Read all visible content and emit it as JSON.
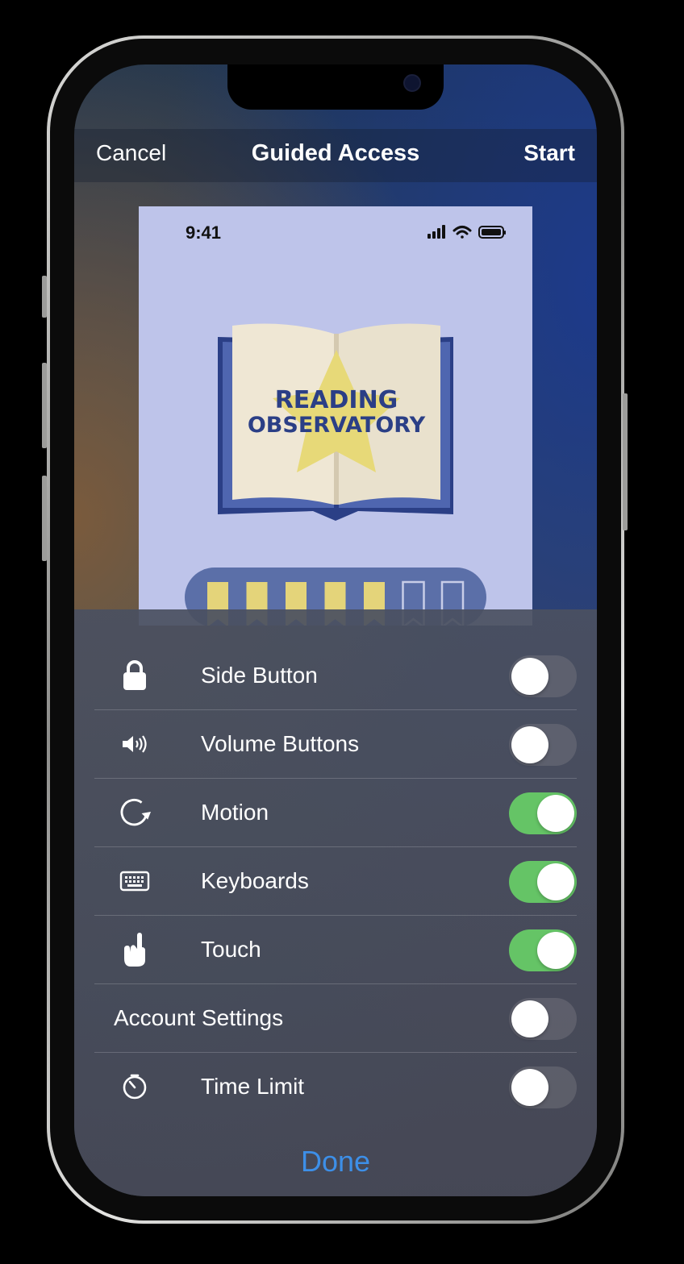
{
  "navbar": {
    "cancel": "Cancel",
    "title": "Guided Access",
    "start": "Start"
  },
  "preview": {
    "status_time": "9:41",
    "app_title_line1": "READING",
    "app_title_line2": "OBSERVATORY",
    "progress": {
      "filled": 5,
      "total": 7
    }
  },
  "options": [
    {
      "label": "Side Button",
      "icon": "lock-icon",
      "enabled": false
    },
    {
      "label": "Volume Buttons",
      "icon": "speaker-icon",
      "enabled": false
    },
    {
      "label": "Motion",
      "icon": "rotate-icon",
      "enabled": true
    },
    {
      "label": "Keyboards",
      "icon": "keyboard-icon",
      "enabled": true
    },
    {
      "label": "Touch",
      "icon": "hand-pointing-icon",
      "enabled": true
    },
    {
      "label": "Account Settings",
      "icon": "",
      "enabled": false
    },
    {
      "label": "Time Limit",
      "icon": "timer-icon",
      "enabled": false
    }
  ],
  "done_label": "Done",
  "colors": {
    "toggle_on": "#65c466",
    "accent": "#3d8fe8",
    "book_blue": "#2b3f86",
    "star": "#e7d978"
  }
}
